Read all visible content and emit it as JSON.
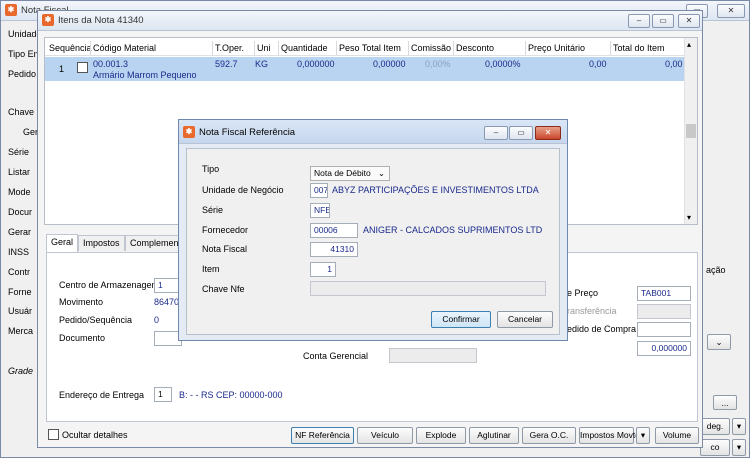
{
  "main_window": {
    "title": "Nota Fiscal",
    "left_labels": [
      "Unidade",
      "Tipo Emis",
      "Pedido",
      "Chave N",
      "Ger",
      "Série",
      "Listar",
      "Mode",
      "Docur",
      "Gerar",
      "INSS",
      "Contr",
      "Forne",
      "Usuár",
      "Merca",
      "Grade"
    ],
    "right_labels": {
      "preco": "e Preço",
      "transferencia": "ransferência",
      "pedido_compra": "edido de Compra",
      "acao": "ação"
    },
    "tabela_preco": "TAB001",
    "valor": "0,000000",
    "bottom_buttons": [
      "deg.",
      "co"
    ]
  },
  "itens_window": {
    "title": "Itens da Nota 41340",
    "columns": [
      "Sequência",
      "Código Material",
      "T.Oper.",
      "Uni",
      "Quantidade",
      "Peso Total Item",
      "Comissão",
      "Desconto",
      "Preço Unitário",
      "Total do Item"
    ],
    "row": {
      "sequencia": "1",
      "codigo": "00.001.3",
      "descricao": "Armário Marrom Pequeno",
      "toper": "592.7",
      "uni": "KG",
      "quantidade": "0,000000",
      "peso": "0,00000",
      "comissao": "0,00%",
      "desconto": "0,0000%",
      "preco": "0,00",
      "total": "0,00"
    },
    "tabs": [
      "Geral",
      "Impostos",
      "Complemento"
    ],
    "form": {
      "centro_label": "Centro de Armazenagem",
      "centro_value": "1",
      "movimento_label": "Movimento",
      "movimento_value": "86470",
      "pedido_label": "Pedido/Sequência",
      "pedido_value": "0",
      "documento_label": "Documento",
      "conta_label": "Conta Gerencial",
      "endereco_label": "Endereço de Entrega",
      "endereco_num": "1",
      "endereco_text": "B:  -  - RS CEP: 00000-000"
    },
    "ocultar_label": "Ocultar detalhes",
    "buttons": {
      "nf_referencia": "NF Referência",
      "veiculo": "Veículo",
      "explode": "Explode",
      "aglutinar": "Aglutinar",
      "gera_oc": "Gera O.C.",
      "impostos": "Impostos Movto",
      "volume": "Volume"
    }
  },
  "dialog": {
    "title": "Nota Fiscal Referência",
    "tipo_label": "Tipo",
    "tipo_value": "Nota de Débito",
    "unidade_label": "Unidade de Negócio",
    "unidade_code": "007",
    "unidade_name": "ABYZ PARTICIPAÇÕES E INVESTIMENTOS LTDA",
    "serie_label": "Série",
    "serie_value": "NFE",
    "fornecedor_label": "Fornecedor",
    "fornecedor_code": "00006",
    "fornecedor_name": "ANIGER - CALCADOS SUPRIMENTOS LTD",
    "nota_label": "Nota Fiscal",
    "nota_value": "41310",
    "item_label": "Item",
    "item_value": "1",
    "chave_label": "Chave Nfe",
    "confirmar": "Confirmar",
    "cancelar": "Cancelar"
  }
}
